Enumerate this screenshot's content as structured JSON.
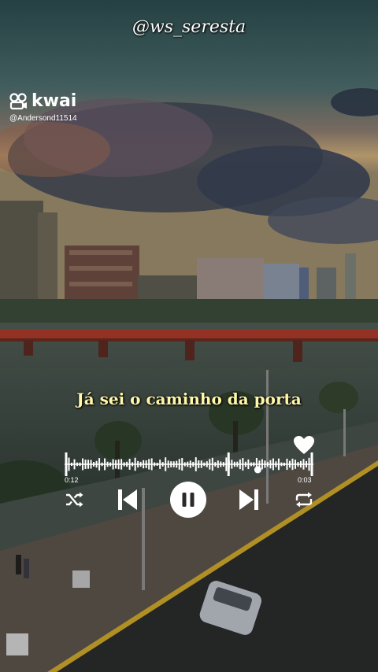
{
  "overlay": {
    "handle": "@ws_seresta"
  },
  "kwai": {
    "name": "kwai",
    "user": "@Andersond11514"
  },
  "lyric": {
    "text": "Já sei o caminho da porta"
  },
  "player": {
    "current_time": "0:12",
    "duration": "0:03",
    "progress": 0.78,
    "icons": [
      "heart-icon",
      "shuffle-icon",
      "previous-icon",
      "pause-icon",
      "next-icon",
      "repeat-icon"
    ],
    "accent": "#ffffff"
  }
}
